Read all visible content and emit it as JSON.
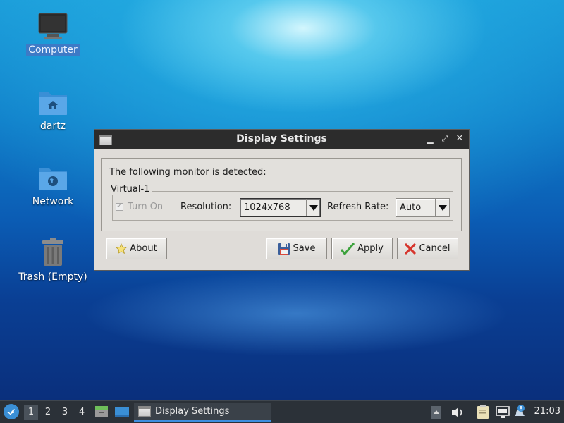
{
  "desktop": {
    "icons": [
      {
        "label": "Computer",
        "icon": "computer-icon"
      },
      {
        "label": "dartz",
        "icon": "home-folder-icon"
      },
      {
        "label": "Network",
        "icon": "network-folder-icon"
      },
      {
        "label": "Trash (Empty)",
        "icon": "trash-icon"
      }
    ]
  },
  "dialog": {
    "title": "Display Settings",
    "detected_text": "The following monitor is detected:",
    "monitor_name": "Virtual-1",
    "turn_on_label": "Turn On",
    "resolution_label": "Resolution:",
    "resolution_value": "1024x768",
    "refresh_label": "Refresh Rate:",
    "refresh_value": "Auto",
    "buttons": {
      "about": "About",
      "save": "Save",
      "apply": "Apply",
      "cancel": "Cancel"
    }
  },
  "taskbar": {
    "workspaces": [
      "1",
      "2",
      "3",
      "4"
    ],
    "active_workspace": "1",
    "task_title": "Display Settings",
    "clock": "21:03"
  },
  "colors": {
    "accent": "#3d8ee0",
    "titlebar": "#2c2c2c",
    "dialog_bg": "#dfdcd8",
    "taskbar_bg": "#2b3138"
  }
}
